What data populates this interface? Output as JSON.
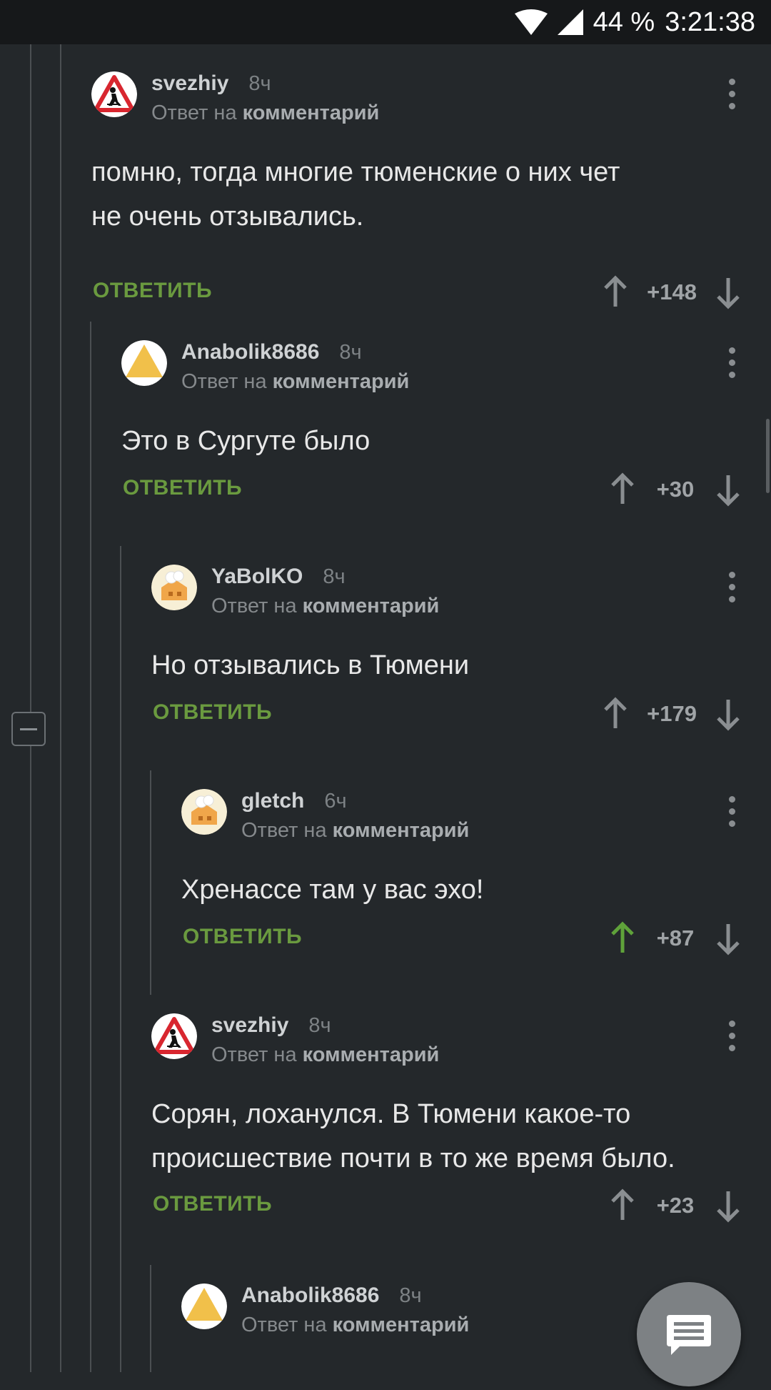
{
  "status_bar": {
    "battery": "44 %",
    "time": "3:21:38"
  },
  "reply_prefix": "Ответ на",
  "reply_target": "комментарий",
  "reply_button": "ОТВЕТИТЬ",
  "comments": [
    {
      "author": "svezhiy",
      "time": "8ч",
      "avatar": "road-work-sign",
      "text_lines": [
        "помню, тогда многие тюменские о них чет",
        "не очень отзывались."
      ],
      "score": "+148",
      "upvoted": false
    },
    {
      "author": "Anabolik8686",
      "time": "8ч",
      "avatar": "yellow-triangle",
      "text_lines": [
        "Это в Сургуте было"
      ],
      "score": "+30",
      "upvoted": false
    },
    {
      "author": "YaBolKO",
      "time": "8ч",
      "avatar": "chef-hat-house",
      "text_lines": [
        "Но отзывались в Тюмени"
      ],
      "score": "+179",
      "upvoted": false
    },
    {
      "author": "gletch",
      "time": "6ч",
      "avatar": "chef-hat-house",
      "text_lines": [
        "Хренассе там у вас эхо!"
      ],
      "score": "+87",
      "upvoted": true
    },
    {
      "author": "svezhiy",
      "time": "8ч",
      "avatar": "road-work-sign",
      "text_lines": [
        "Сорян, лоханулся. В Тюмени какое-то",
        "происшествие почти в то же время было."
      ],
      "score": "+23",
      "upvoted": false
    },
    {
      "author": "Anabolik8686",
      "time": "8ч",
      "avatar": "yellow-triangle",
      "text_lines": [],
      "score": "",
      "upvoted": false
    }
  ],
  "colors": {
    "background": "#24282b",
    "accent_green": "#6a9a3f",
    "status_bar": "#16181a"
  }
}
